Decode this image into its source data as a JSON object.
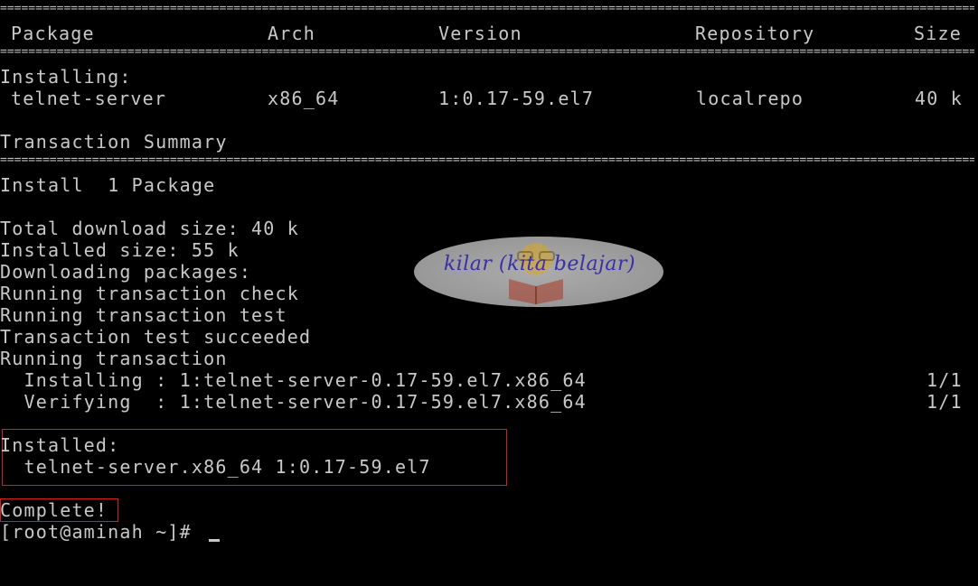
{
  "table": {
    "headers": {
      "package": "Package",
      "arch": "Arch",
      "version": "Version",
      "repository": "Repository",
      "size": "Size"
    },
    "installing_label": "Installing:",
    "row": {
      "package": "telnet-server",
      "arch": "x86_64",
      "version": "1:0.17-59.el7",
      "repository": "localrepo",
      "size": "40 k"
    }
  },
  "summary": {
    "title": "Transaction Summary",
    "install_line": "Install  1 Package"
  },
  "log": {
    "total_download": "Total download size: 40 k",
    "installed_size": "Installed size: 55 k",
    "downloading": "Downloading packages:",
    "check": "Running transaction check",
    "test": "Running transaction test",
    "test_ok": "Transaction test succeeded",
    "running": "Running transaction",
    "installing_step": "  Installing : 1:telnet-server-0.17-59.el7.x86_64",
    "installing_count": "1/1",
    "verifying_step": "  Verifying  : 1:telnet-server-0.17-59.el7.x86_64",
    "verifying_count": "1/1",
    "installed_label": "Installed:",
    "installed_pkg": "  telnet-server.x86_64 1:0.17-59.el7",
    "complete": "Complete!",
    "prompt": "[root@aminah ~]# "
  },
  "watermark": {
    "text": "kilar (kita belajar)",
    "icon": "reading-face-icon"
  },
  "colors": {
    "background": "#000000",
    "text": "#c8c8c8",
    "highlight": "#d21e1e",
    "watermark_text": "#3a2fa8"
  }
}
